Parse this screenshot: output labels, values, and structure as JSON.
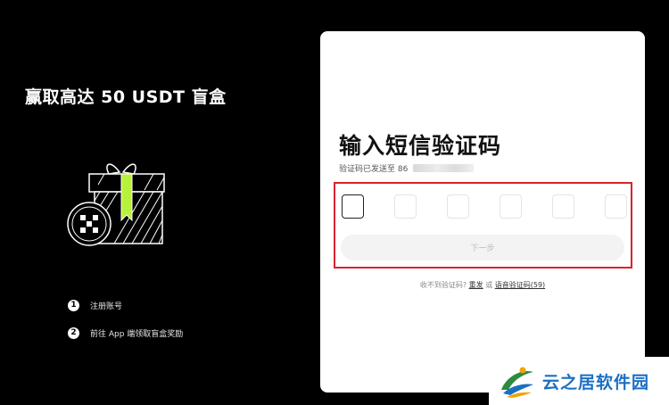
{
  "promo": {
    "title": "赢取高达 50 USDT 盲盒",
    "steps": [
      {
        "num": "1",
        "text": "注册账号"
      },
      {
        "num": "2",
        "text": "前往 App 端领取盲盒奖励"
      }
    ]
  },
  "card": {
    "title": "输入短信验证码",
    "subtitle": "验证码已发送至 86",
    "code_boxes": [
      "",
      "",
      "",
      "",
      "",
      ""
    ],
    "next_label": "下一步",
    "resend": {
      "prefix": "收不到验证码?",
      "resend_link": "重发",
      "or": "或",
      "voice_link": "语音验证码(59)"
    }
  },
  "watermark": {
    "text": "云之居软件园"
  },
  "colors": {
    "background": "#000000",
    "card": "#ffffff",
    "highlight": "#d9232f",
    "accent_green": "#b6f23a",
    "watermark_blue": "#1a6fc4"
  }
}
